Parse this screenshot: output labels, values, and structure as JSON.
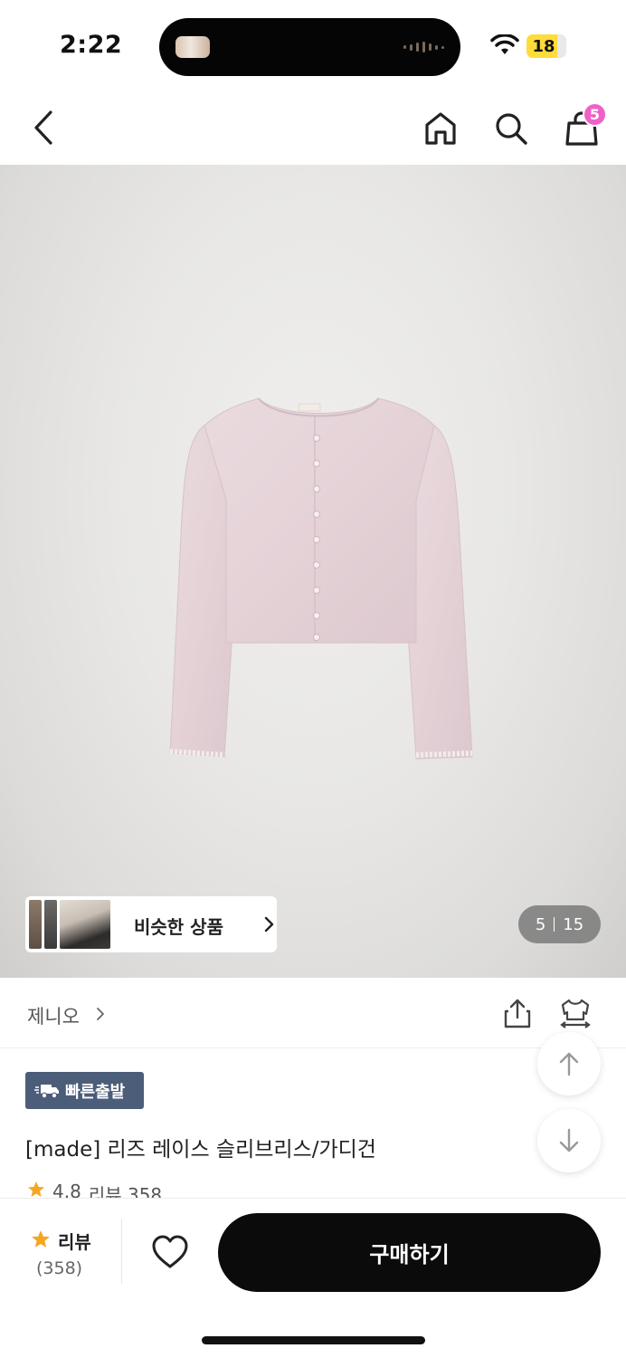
{
  "status_bar": {
    "time": "2:22",
    "battery": "18"
  },
  "nav": {
    "cart_count": "5"
  },
  "gallery": {
    "similar_label": "비슷한 상품",
    "current_page": "5",
    "total_pages": "15"
  },
  "brand": {
    "name": "제니오"
  },
  "product": {
    "badge": "빠른출발",
    "title": "[made] 리즈 레이스 슬리브리스/가디건",
    "rating": "4.8",
    "review_label": "리뷰 358"
  },
  "bottom": {
    "review_label": "리뷰",
    "review_count": "(358)",
    "buy_label": "구매하기"
  },
  "colors": {
    "accent": "#f060c8",
    "badge_bg": "#4c5d79",
    "star": "#f5a623",
    "cta": "#0b0b0b"
  },
  "icons": [
    "back-icon",
    "home-icon",
    "search-icon",
    "cart-icon",
    "share-icon",
    "hanger-icon",
    "truck-icon",
    "star-icon",
    "heart-icon",
    "arrow-up-icon",
    "arrow-down-icon",
    "chevron-right-icon",
    "wifi-icon"
  ]
}
